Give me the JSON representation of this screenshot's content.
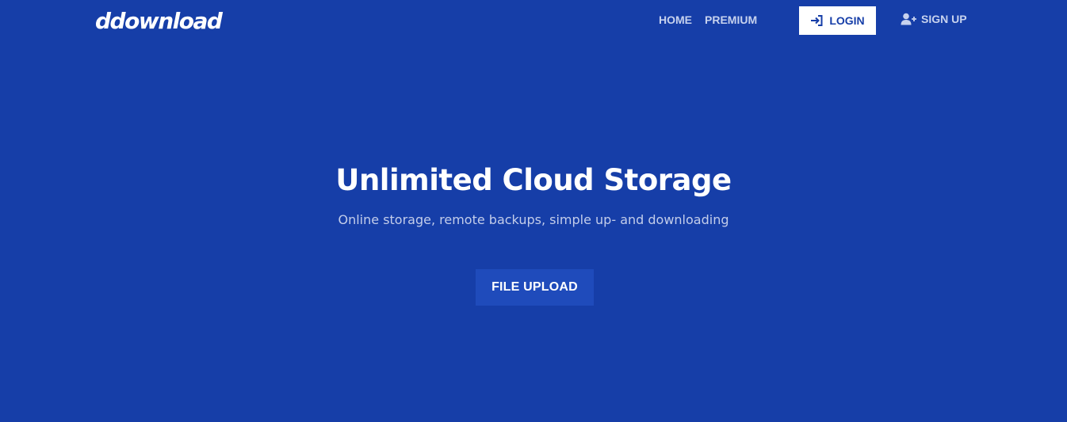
{
  "brand": {
    "logo_text": "ddownload"
  },
  "nav": {
    "home_label": "HOME",
    "premium_label": "PREMIUM",
    "login_label": "LOGIN",
    "login_icon": "sign-in-icon",
    "signup_label": "SIGN UP",
    "signup_icon": "user-plus-icon"
  },
  "hero": {
    "title": "Unlimited Cloud Storage",
    "subtitle": "Online storage, remote backups, simple up- and downloading",
    "upload_label": "FILE UPLOAD"
  },
  "colors": {
    "background": "#163ea8",
    "upload_button": "#1f4bbb",
    "nav_text": "#c7d2ee",
    "login_bg": "#ffffff"
  }
}
